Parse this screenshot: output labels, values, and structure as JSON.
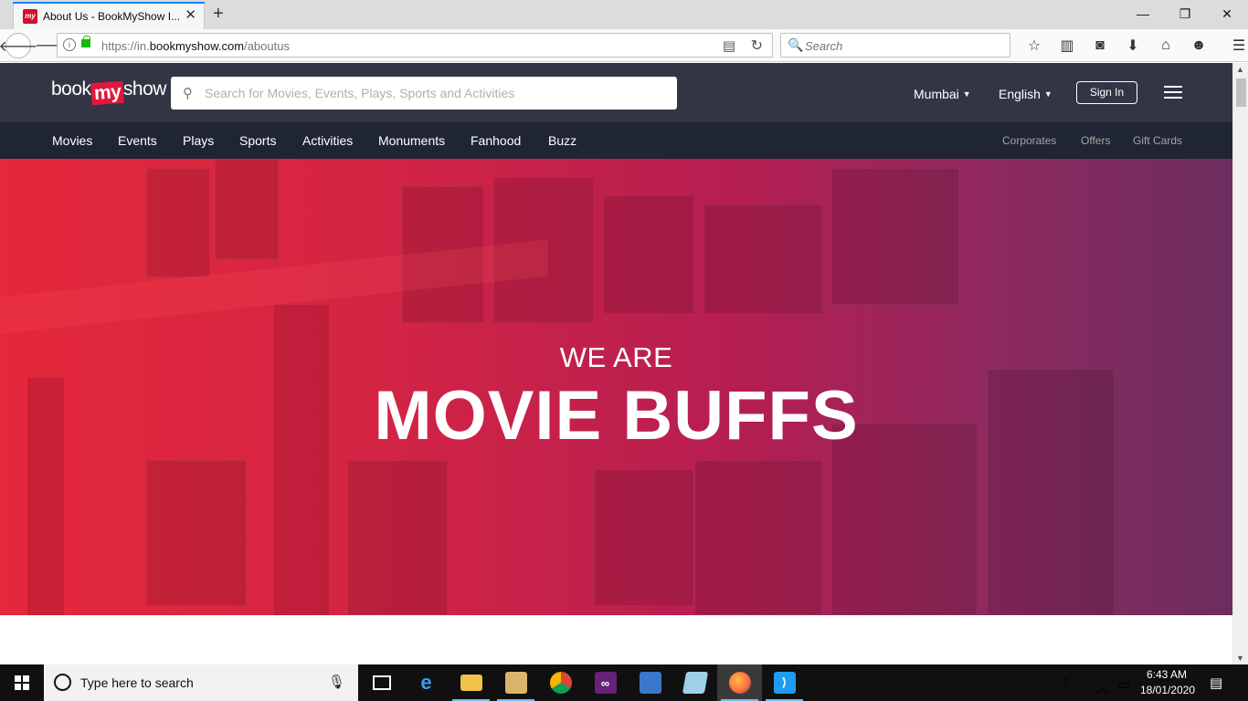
{
  "browser": {
    "tab_title": "About Us - BookMyShow I...",
    "new_tab_symbol": "+",
    "url_prefix": "https://in.",
    "url_domain": "bookmyshow.com",
    "url_path": "/aboutus",
    "search_placeholder": "Search",
    "icons": [
      "bookmark-star-icon",
      "library-icon",
      "pocket-icon",
      "downloads-icon",
      "home-icon",
      "sync-icon",
      "menu-icon"
    ]
  },
  "site": {
    "logo_book": "book",
    "logo_my": "my",
    "logo_show": "show",
    "search_placeholder": "Search for Movies, Events, Plays, Sports and Activities",
    "city": "Mumbai",
    "language": "English",
    "signin_label": "Sign In"
  },
  "subnav": {
    "left": [
      "Movies",
      "Events",
      "Plays",
      "Sports",
      "Activities",
      "Monuments",
      "Fanhood",
      "Buzz"
    ],
    "right": [
      "Corporates",
      "Offers",
      "Gift Cards"
    ]
  },
  "hero": {
    "subtitle": "WE ARE",
    "title": "MOVIE BUFFS"
  },
  "taskbar": {
    "search_placeholder": "Type here to search",
    "time": "6:43 AM",
    "date": "18/01/2020",
    "apps": [
      "task-view-icon",
      "edge-icon",
      "file-explorer-icon",
      "app-icon",
      "chrome-icon",
      "visual-studio-icon",
      "remote-desktop-icon",
      "notepad-icon",
      "firefox-icon",
      "vscode-icon"
    ]
  },
  "colors": {
    "header_bg": "#333545",
    "subnav_bg": "#1f2533",
    "brand_red": "#e3173e",
    "hero_start": "#e5283b",
    "hero_end": "#6c2d5e"
  }
}
